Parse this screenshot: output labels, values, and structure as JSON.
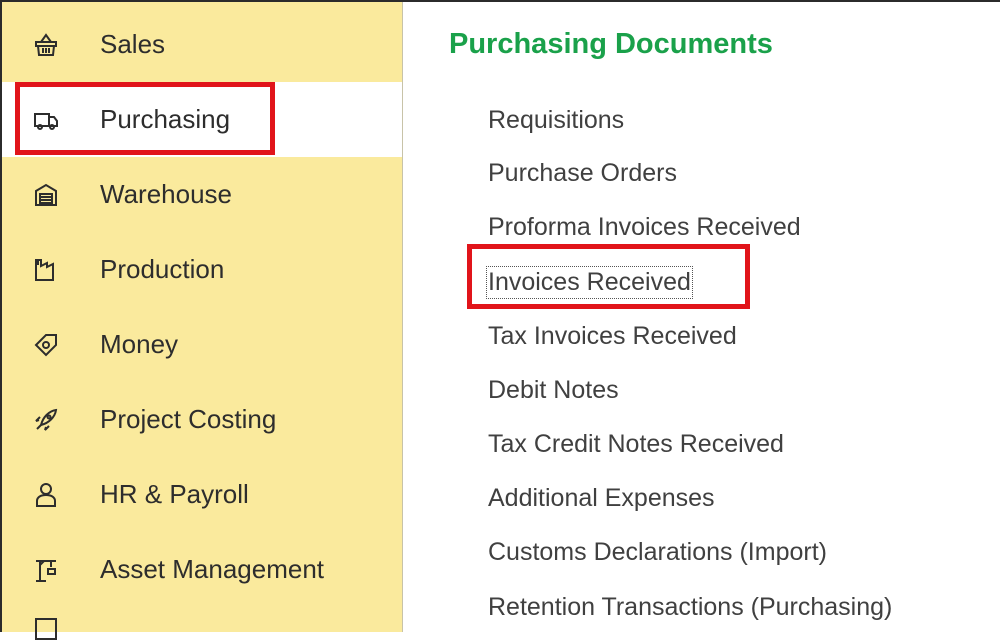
{
  "sidebar": {
    "items": [
      {
        "label": "Sales",
        "icon": "basket-icon"
      },
      {
        "label": "Purchasing",
        "icon": "truck-icon",
        "active": true
      },
      {
        "label": "Warehouse",
        "icon": "warehouse-icon"
      },
      {
        "label": "Production",
        "icon": "factory-icon"
      },
      {
        "label": "Money",
        "icon": "tag-money-icon"
      },
      {
        "label": "Project Costing",
        "icon": "rocket-icon"
      },
      {
        "label": "HR & Payroll",
        "icon": "person-icon"
      },
      {
        "label": "Asset Management",
        "icon": "crane-icon"
      }
    ]
  },
  "main": {
    "title": "Purchasing Documents",
    "links": [
      "Requisitions",
      "Purchase Orders",
      "Proforma Invoices Received",
      "Invoices Received",
      "Tax Invoices Received",
      "Debit Notes",
      "Tax Credit Notes Received",
      "Additional Expenses",
      "Customs Declarations (Import)",
      "Retention Transactions (Purchasing)"
    ]
  },
  "colors": {
    "sidebar_bg": "#faea9d",
    "title_green": "#1aa14a",
    "highlight_red": "#e1141a"
  }
}
